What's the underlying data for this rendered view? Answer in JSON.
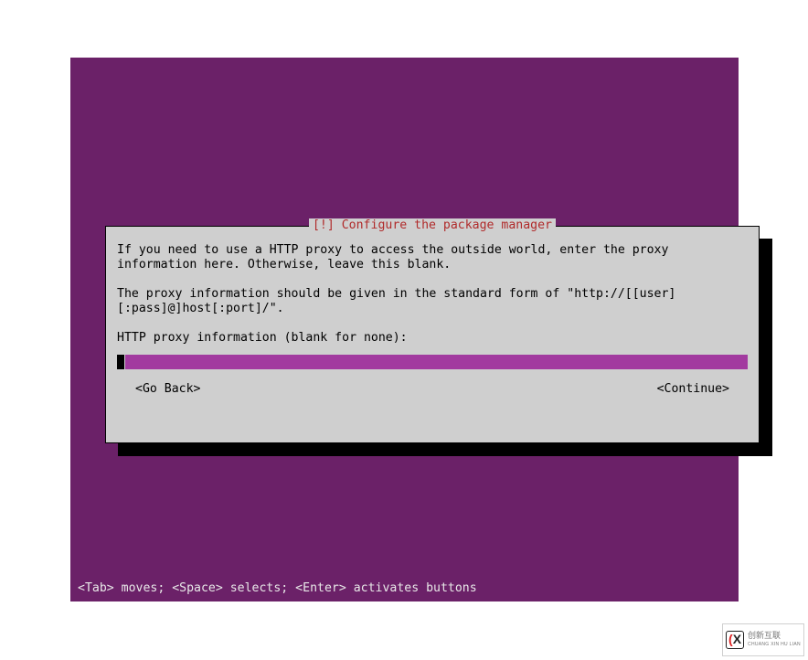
{
  "colors": {
    "background_purple": "#6b2168",
    "dialog_bg": "#cfcfcf",
    "input_highlight": "#a23a9f",
    "title_red": "#b02a2a"
  },
  "dialog": {
    "title": "[!] Configure the package manager",
    "paragraph1": "If you need to use a HTTP proxy to access the outside world, enter the proxy information here. Otherwise, leave this blank.",
    "paragraph2": "The proxy information should be given in the standard form of \"http://[[user][:pass]@]host[:port]/\".",
    "prompt_label": "HTTP proxy information (blank for none):",
    "input_value": "",
    "go_back_label": "<Go Back>",
    "continue_label": "<Continue>"
  },
  "hint_bar": "<Tab> moves; <Space> selects; <Enter> activates buttons",
  "watermark": {
    "brand_cn": "创新互联",
    "brand_py": "CHUANG XIN HU LIAN"
  }
}
